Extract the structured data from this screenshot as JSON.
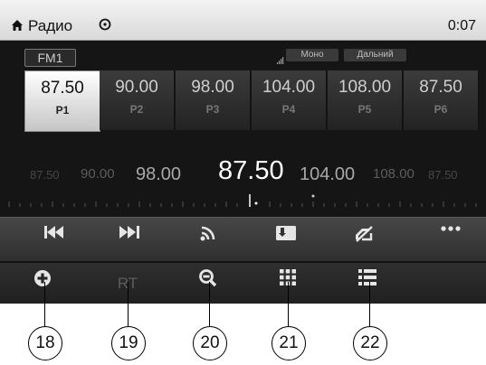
{
  "status_bar": {
    "app_title": "Радио",
    "clock": "0:07",
    "icons": [
      "home-icon",
      "clock-status-icon"
    ]
  },
  "tuner": {
    "band": "FM1",
    "mode_badge": "Моно",
    "range_badge": "Дальний",
    "signal_icon": "signal-strength-icon"
  },
  "presets": [
    {
      "freq": "87.50",
      "label": "P1",
      "active": true
    },
    {
      "freq": "90.00",
      "label": "P2",
      "active": false
    },
    {
      "freq": "98.00",
      "label": "P3",
      "active": false
    },
    {
      "freq": "104.00",
      "label": "P4",
      "active": false
    },
    {
      "freq": "108.00",
      "label": "P5",
      "active": false
    },
    {
      "freq": "87.50",
      "label": "P6",
      "active": false
    }
  ],
  "dial": {
    "current": "87.50",
    "near_left": "98.00",
    "near_right": "104.00",
    "far_left": [
      "87.50",
      "90.00"
    ],
    "far_right": [
      "108.00",
      "87.50"
    ]
  },
  "controls": [
    "previous-icon",
    "next-icon",
    "scan-icon",
    "memory-card-icon",
    "mute-icon",
    "more-icon"
  ],
  "toolbar": {
    "rt_label": "RT",
    "icons": [
      "add-icon",
      "rt-label",
      "zoom-out-icon",
      "keypad-icon",
      "list-icon"
    ]
  },
  "callouts": [
    "18",
    "19",
    "20",
    "21",
    "22"
  ],
  "colors": {
    "active_preset": "#d8d8d8",
    "screen_bg": "#151515",
    "toolbar_bg": "#262626",
    "status_bg": "#e5e5e5"
  }
}
